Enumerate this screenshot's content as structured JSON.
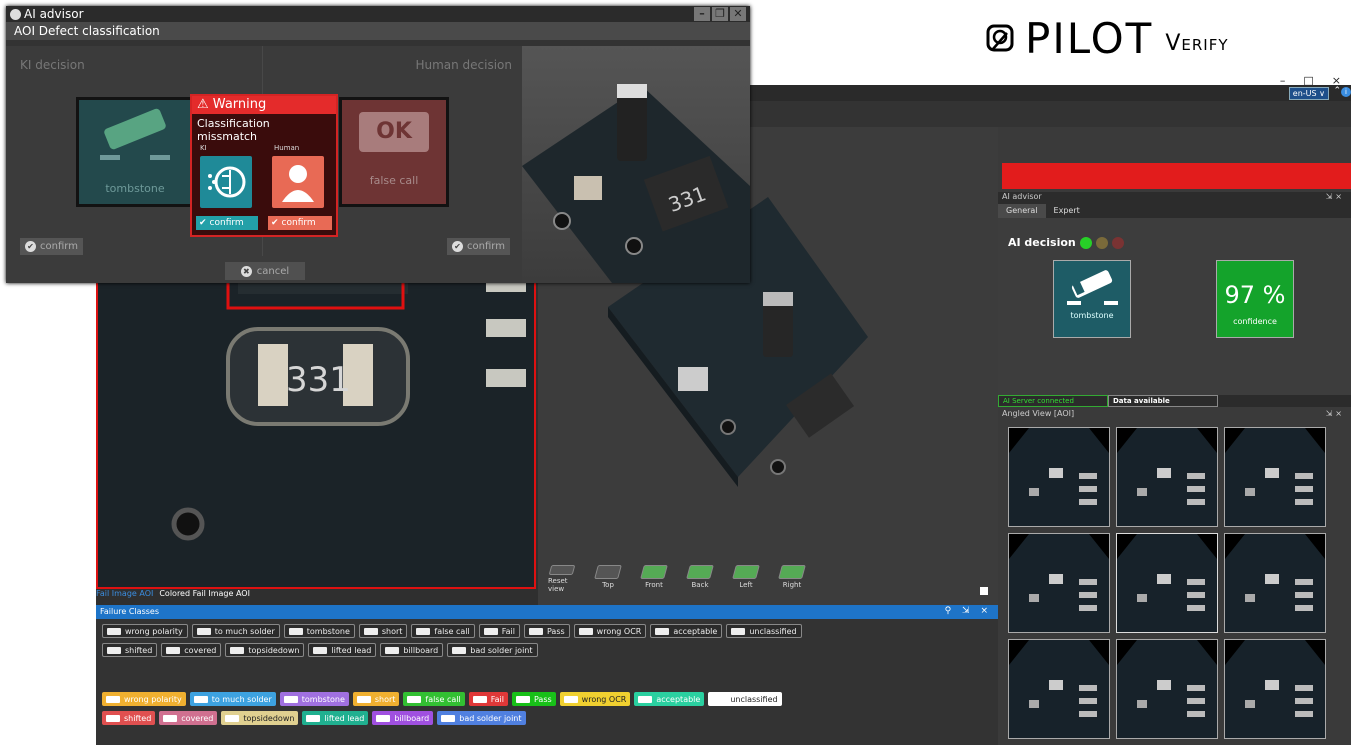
{
  "brand": {
    "name": "PILOT",
    "sub": "Verify"
  },
  "app": {
    "window_controls": [
      "–",
      "□",
      "×"
    ],
    "language": "en-US ∨",
    "left_tabs": {
      "fail_image": "Fail Image AOI",
      "colored_fail_image": "Colored Fail Image AOI"
    },
    "view_buttons": [
      "Reset view",
      "Top",
      "Front",
      "Back",
      "Left",
      "Right"
    ],
    "failure_classes": {
      "title": "Failure Classes",
      "row_outlined_1": [
        "wrong polarity",
        "to much solder",
        "tombstone",
        "short",
        "false call",
        "Fail",
        "Pass",
        "wrong OCR",
        "acceptable",
        "unclassified"
      ],
      "row_outlined_2": [
        "shifted",
        "covered",
        "topsidedown",
        "lifted lead",
        "billboard",
        "bad solder joint"
      ],
      "row_filled_1": [
        "wrong polarity",
        "to much solder",
        "tombstone",
        "short",
        "false call",
        "Fail",
        "Pass",
        "wrong OCR",
        "acceptable",
        "unclassified"
      ],
      "row_filled_2": [
        "shifted",
        "covered",
        "topsidedown",
        "lifted lead",
        "billboard",
        "bad solder joint"
      ],
      "colors_row1": [
        "#f0b030",
        "#3da2e0",
        "#a070e0",
        "#f0b030",
        "#32c032",
        "#e03838",
        "#18c018",
        "#f0d030",
        "#2ad0a0",
        "#ffffff"
      ],
      "colors_row2": [
        "#e05050",
        "#d07090",
        "#e0d090",
        "#20b090",
        "#a050e0",
        "#5080e0"
      ]
    },
    "advisor": {
      "title": "AI advisor",
      "tabs": [
        "General",
        "Expert"
      ],
      "decision_label": "AI decision",
      "decision_class": "tombstone",
      "confidence_value": "97 %",
      "confidence_label": "confidence",
      "dot_colors": [
        "#27d027",
        "#7a6a3a",
        "#7a3333"
      ]
    },
    "status": {
      "server": "AI Server connected",
      "data": "Data available"
    },
    "angled_view_title": "Angled View [AOI]"
  },
  "overlay": {
    "app_name": "AI advisor",
    "subtitle": "AOI Defect classification",
    "ki_decision": "KI decision",
    "human_decision": "Human decision",
    "ki_class": "tombstone",
    "human_class": "false call",
    "human_badge": "OK",
    "confirm": "confirm",
    "cancel": "cancel",
    "warning": {
      "title": "Warning",
      "text": "Classification missmatch",
      "ki_label": "KI",
      "human_label": "Human",
      "confirm": "confirm"
    }
  }
}
